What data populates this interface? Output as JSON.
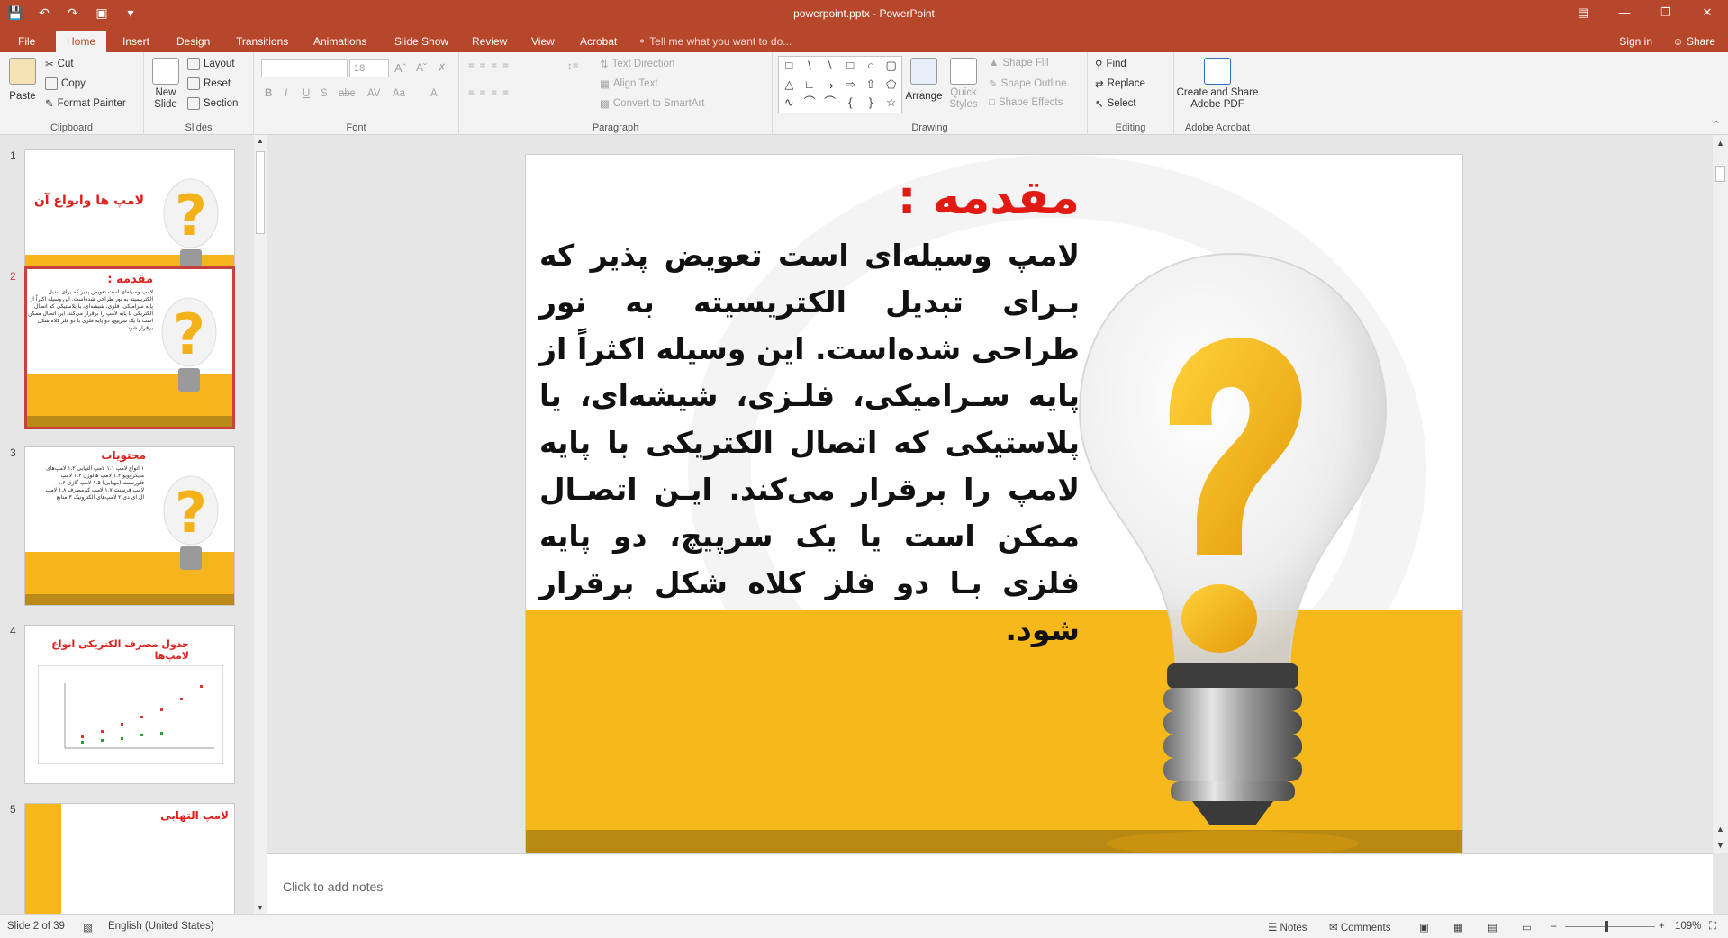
{
  "window": {
    "title": "powerpoint.pptx - PowerPoint"
  },
  "tabs": [
    "File",
    "Home",
    "Insert",
    "Design",
    "Transitions",
    "Animations",
    "Slide Show",
    "Review",
    "View",
    "Acrobat"
  ],
  "tell_me": "Tell me what you want to do...",
  "account": {
    "sign_in": "Sign in",
    "share": "Share"
  },
  "ribbon": {
    "clipboard": {
      "label": "Clipboard",
      "paste": "Paste",
      "cut": "Cut",
      "copy": "Copy",
      "format_painter": "Format Painter"
    },
    "slides": {
      "label": "Slides",
      "new_slide_1": "New",
      "new_slide_2": "Slide",
      "layout": "Layout",
      "reset": "Reset",
      "section": "Section"
    },
    "font": {
      "label": "Font",
      "font_size": "18"
    },
    "paragraph": {
      "label": "Paragraph",
      "text_direction": "Text Direction",
      "align_text": "Align Text",
      "smartart": "Convert to SmartArt"
    },
    "drawing": {
      "label": "Drawing",
      "arrange": "Arrange",
      "quick_styles_1": "Quick",
      "quick_styles_2": "Styles",
      "shape_fill": "Shape Fill",
      "shape_outline": "Shape Outline",
      "shape_effects": "Shape Effects"
    },
    "editing": {
      "label": "Editing",
      "find": "Find",
      "replace": "Replace",
      "select": "Select"
    },
    "acrobat": {
      "label": "Adobe Acrobat",
      "create_1": "Create and Share",
      "create_2": "Adobe PDF"
    }
  },
  "thumbnails": [
    {
      "num": "1",
      "title": "لامپ ها وانواع آن"
    },
    {
      "num": "2",
      "title": "مقدمه :",
      "text": "لامپ وسیله‌ای است تعویض پذیر که برای تبدیل الکتریسیته به نور طراحی شده‌است. این وسیله اکثراً از پایه سرامیکی، فلزی، شیشه‌ای، یا پلاستیکی که اتصال الکتریکی با پایه لامپ را برقرار می‌کند. این اتصال ممکن است یا یک سرپیچ، دو پایه فلزی با دو فلز کلاه شکل برقرار شود."
    },
    {
      "num": "3",
      "title": "محتویات",
      "text": "۱ انواع لامپ ۱.۱ لامپ التهابی ۱.۲ لامپ‌های مایکروویو ۱.۳ لامپ هالوژن ۱.۴ لامپ فلورسنت (مهتابی) ۱.۵ لامپ گازی ۱.۶ لامپ فرسنت ۱.۷ لامپ کم‌مصرف ۱.۸ لامپ ال ای دی ۲ لامپ‌های الکترونیک ۳ منابع"
    },
    {
      "num": "4",
      "title": "جدول مصرف الکتریکی انواع لامپ‌ها"
    },
    {
      "num": "5",
      "title": "لامپ التهابی"
    }
  ],
  "slide": {
    "title": "مقدمه :",
    "body": "لامپ وسیله‌ای است تعویض پذیر که بـرای تبدیل الکتریسیته به نور طراحی شده‌است. این وسیله اکثراً از پایه سـرامیکی، فلـزی، شیشه‌ای، یا پلاستیکی که اتصال الکتریکی با پایه لامپ را برقرار می‌کند. ایـن اتصـال ممکن است یا یک سرپیچ، دو پایه فلزی بـا دو فلز کلاه شکل برقرار شود."
  },
  "notes_placeholder": "Click to add notes",
  "status": {
    "slide_info": "Slide 2 of 39",
    "language": "English (United States)",
    "notes": "Notes",
    "comments": "Comments",
    "zoom": "109%"
  },
  "colors": {
    "accent": "#b7472a",
    "slide_title": "#e11b14",
    "band": "#f7b81c"
  }
}
